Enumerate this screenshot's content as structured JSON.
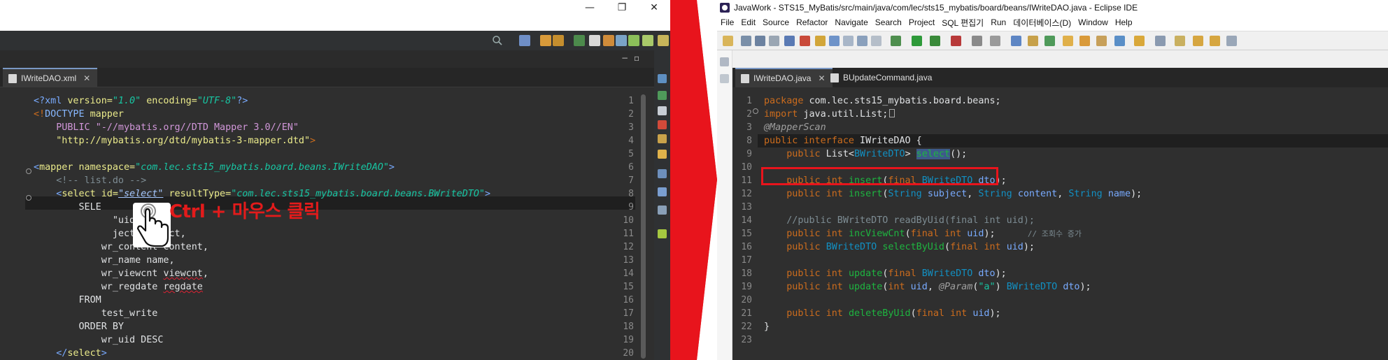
{
  "left": {
    "window_controls": [
      "—",
      "❐",
      "✕"
    ],
    "tab": {
      "label": "IWriteDAO.xml"
    },
    "view_buttons": [
      "−",
      "▫"
    ],
    "lines": [
      {
        "n": "1"
      },
      {
        "n": "2"
      },
      {
        "n": "3"
      },
      {
        "n": "4"
      },
      {
        "n": "5"
      },
      {
        "n": "6"
      },
      {
        "n": "7"
      },
      {
        "n": "8"
      },
      {
        "n": "9"
      },
      {
        "n": "10"
      },
      {
        "n": "11"
      },
      {
        "n": "12"
      },
      {
        "n": "13"
      },
      {
        "n": "14"
      },
      {
        "n": "15"
      },
      {
        "n": "16"
      },
      {
        "n": "17"
      },
      {
        "n": "18"
      },
      {
        "n": "19"
      },
      {
        "n": "20"
      }
    ],
    "code": {
      "l1_a": "<?",
      "l1_b": "xml",
      "l1_c": " version=",
      "l1_d": "\"1.0\"",
      "l1_e": " encoding=",
      "l1_f": "\"UTF-8\"",
      "l1_g": "?>",
      "l2_a": "<!",
      "l2_b": "DOCTYPE",
      "l2_c": " mapper",
      "l3_a": "    PUBLIC ",
      "l3_b": "\"-//mybatis.org//DTD Mapper 3.0//EN\"",
      "l4_a": "    ",
      "l4_b": "\"http://mybatis.org/dtd/mybatis-3-mapper.dtd\"",
      "l4_c": ">",
      "l6_a": "<",
      "l6_b": "mapper",
      "l6_c": " namespace=",
      "l6_d": "\"com.lec.sts15_mybatis.board.beans.IWriteDAO\"",
      "l6_e": ">",
      "l7": "    <!-- list.do -->",
      "l8_a": "    <",
      "l8_b": "select",
      "l8_c": " id=",
      "l8_d": "\"select\"",
      "l8_e": " resultType=",
      "l8_f": "\"com.lec.sts15_mybatis.board.beans.BWriteDTO\"",
      "l8_g": ">",
      "l9": "        SELE",
      "l10": "              \"uid\",",
      "l11": "              ject subject,",
      "l12": "            wr_content content,",
      "l13": "            wr_name name,",
      "l14_a": "            wr_viewcnt ",
      "l14_b": "viewcnt",
      "l14_c": ",",
      "l15_a": "            wr_regdate ",
      "l15_b": "regdate",
      "l16": "        FROM",
      "l17": "            test_write",
      "l18": "        ORDER BY",
      "l19": "            wr_uid DESC",
      "l20_a": "    </",
      "l20_b": "select",
      "l20_c": ">"
    },
    "overlay_caption": "Ctrl + 마우스 클릭"
  },
  "right": {
    "title": "JavaWork - STS15_MyBatis/src/main/java/com/lec/sts15_mybatis/board/beans/IWriteDAO.java - Eclipse IDE",
    "menu": [
      "File",
      "Edit",
      "Source",
      "Refactor",
      "Navigate",
      "Search",
      "Project",
      "SQL 편집기",
      "Run",
      "데이터베이스(D)",
      "Window",
      "Help"
    ],
    "tabs": [
      {
        "label": "IWriteDAO.java",
        "close": "✕"
      },
      {
        "label": "BUpdateCommand.java"
      }
    ],
    "lines": [
      "1",
      "2",
      "3",
      "8",
      "9",
      "10",
      "11",
      "12",
      "13",
      "14",
      "15",
      "16",
      "17",
      "18",
      "19",
      "20",
      "21",
      "22",
      "23"
    ],
    "code": {
      "l1_a": "package",
      "l1_b": " com.lec.sts15_mybatis.board.beans;",
      "l3_a": "import",
      "l3_b": " java.util.List;",
      "l8": "@MapperScan",
      "l9_a": "public",
      "l9_b": " ",
      "l9_c": "interface",
      "l9_d": " IWriteDAO {",
      "l10_a": "    public",
      "l10_b": " List<",
      "l10_c": "BWriteDTO",
      "l10_d": "> ",
      "l10_e": "select",
      "l10_f": "();",
      "l12_a": "    public",
      "l12_b": " ",
      "l12_c": "int",
      "l12_d": " ",
      "l12_e": "insert",
      "l12_f": "(",
      "l12_g": "final",
      "l12_h": " ",
      "l12_i": "BWriteDTO",
      "l12_j": " ",
      "l12_k": "dto",
      "l12_l": ");",
      "l13_a": "    public",
      "l13_b": " ",
      "l13_c": "int",
      "l13_d": " ",
      "l13_e": "insert",
      "l13_f": "(",
      "l13_g": "String",
      "l13_h": " ",
      "l13_i": "subject",
      "l13_j": ", ",
      "l13_k": "String",
      "l13_l": " ",
      "l13_m": "content",
      "l13_n": ", ",
      "l13_o": "String",
      "l13_p": " ",
      "l13_q": "name",
      "l13_r": ");",
      "l15": "    //public BWriteDTO readByUid(final int uid);",
      "l16_a": "    public",
      "l16_b": " ",
      "l16_c": "int",
      "l16_d": " ",
      "l16_e": "incViewCnt",
      "l16_f": "(",
      "l16_g": "final",
      "l16_h": " ",
      "l16_i": "int",
      "l16_j": " ",
      "l16_k": "uid",
      "l16_l": ");",
      "l16_m": "       // 조회수 증가",
      "l17_a": "    public",
      "l17_b": " ",
      "l17_c": "BWriteDTO",
      "l17_d": " ",
      "l17_e": "selectByUid",
      "l17_f": "(",
      "l17_g": "final",
      "l17_h": " ",
      "l17_i": "int",
      "l17_j": " ",
      "l17_k": "uid",
      "l17_l": ");",
      "l19_a": "    public",
      "l19_b": " ",
      "l19_c": "int",
      "l19_d": " ",
      "l19_e": "update",
      "l19_f": "(",
      "l19_g": "final",
      "l19_h": " ",
      "l19_i": "BWriteDTO",
      "l19_j": " ",
      "l19_k": "dto",
      "l19_l": ");",
      "l20_a": "    public",
      "l20_b": " ",
      "l20_c": "int",
      "l20_d": " ",
      "l20_e": "update",
      "l20_f": "(",
      "l20_g": "int",
      "l20_h": " ",
      "l20_i": "uid",
      "l20_j": ", ",
      "l20_k": "@Param",
      "l20_l": "(",
      "l20_m": "\"a\"",
      "l20_n": ") ",
      "l20_o": "BWriteDTO",
      "l20_p": " ",
      "l20_q": "dto",
      "l20_r": ");",
      "l22_a": "    public",
      "l22_b": " ",
      "l22_c": "int",
      "l22_d": " ",
      "l22_e": "deleteByUid",
      "l22_f": "(",
      "l22_g": "final",
      "l22_h": " ",
      "l22_i": "int",
      "l22_j": " ",
      "l22_k": "uid",
      "l22_l": ");",
      "l23": "}"
    }
  },
  "colors": {
    "arrow_red": "#e8141c",
    "highlight_box": "#e8141c",
    "editor_bg": "#2f2f2f"
  }
}
